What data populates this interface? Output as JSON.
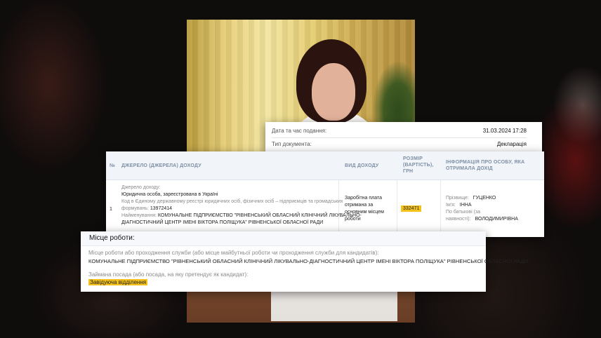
{
  "declaration": {
    "date_label": "Дата та час подання:",
    "date_value": "31.03.2024 17:28",
    "type_label": "Тип документа:",
    "type_value": "Декларація"
  },
  "income_table": {
    "headers": {
      "num": "№",
      "source": "ДЖЕРЕЛО (ДЖЕРЕЛА) ДОХОДУ",
      "kind": "ВИД ДОХОДУ",
      "size_line1": "РОЗМІР",
      "size_line2": "(ВАРТІСТЬ),",
      "size_line3": "ГРН",
      "person_line1": "ІНФОРМАЦІЯ ПРО ОСОБУ, ЯКА",
      "person_line2": "ОТРИМАЛА ДОХІД"
    },
    "row": {
      "num": "1",
      "source_label": "Джерело доходу:",
      "source_type": "Юридична особа, зареєстрована в Україні",
      "code_label_1": "Код в Єдиному державному реєстрі юридичних осіб, фізичних осіб – підприємців та громадських",
      "code_label_2": "формувань:",
      "code_value": "13972414",
      "name_label": "Найменування:",
      "name_value_1": "КОМУНАЛЬНЕ ПІДПРИЄМСТВО \"РІВНЕНСЬКИЙ ОБЛАСНИЙ КЛІНІЧНИЙ ЛІКУВАЛЬНО-",
      "name_value_2": "ДІАГНОСТИЧНИЙ ЦЕНТР ІМЕНІ ВІКТОРА ПОЛІЩУКА\" РІВНЕНСЬКОЇ ОБЛАСНОЇ РАДИ",
      "kind_1": "Заробітна плата",
      "kind_2": "отримана за",
      "kind_3": "основним місцем",
      "kind_4": "роботи",
      "amount": "332471",
      "surname_label": "Прізвище:",
      "surname_value": "ГУЦЕНКО",
      "firstname_label": "Ім'я:",
      "firstname_value": "ІННА",
      "patronymic_label_1": "По батькові (за",
      "patronymic_label_2": "наявності):",
      "patronymic_value": "ВОЛОДИМИРІВНА"
    }
  },
  "workplace": {
    "title": "Місце роботи:",
    "place_label": "Місце роботи або проходження служби (або місце майбутньої роботи чи проходження служби для кандидатів):",
    "place_value": "КОМУНАЛЬНЕ ПІДПРИЄМСТВО \"РІВНЕНСЬКИЙ ОБЛАСНИЙ КЛІНІЧНИЙ ЛІКУВАЛЬНО-ДІАГНОСТИЧНИЙ ЦЕНТР ІМЕНІ ВІКТОРА ПОЛІЩУКА\" РІВНЕНСЬКОЇ ОБЛАСНОЇ РАДИ",
    "position_label": "Займана посада (або посада, на яку претендує як кандидат):",
    "position_value": "Завідуюча відділення"
  },
  "colors": {
    "highlight": "#f5c21b",
    "header_text": "#7d8fa6",
    "header_bg": "#f1f4f8"
  }
}
